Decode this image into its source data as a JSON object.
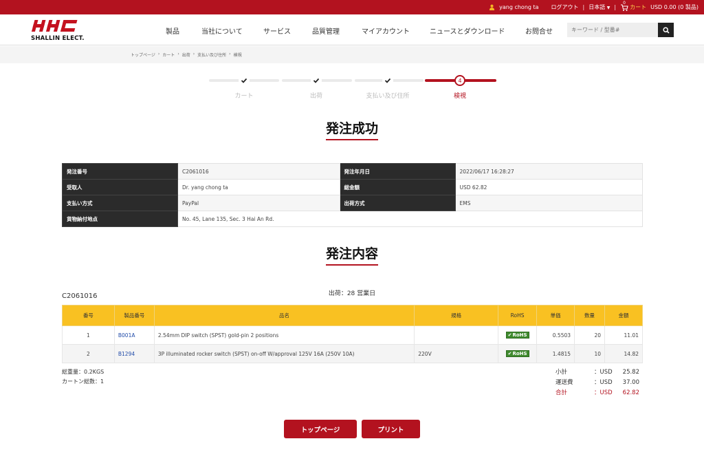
{
  "topbar": {
    "user": "yang chong ta",
    "logout": "ログアウト",
    "language": "日本語",
    "cart_count": "0",
    "cart": "カート",
    "cart_total": "USD 0.00 (0 製品)"
  },
  "header": {
    "logo_brand": "SHALLIN ELECT.",
    "nav": [
      "製品",
      "当社について",
      "サービス",
      "品質管理",
      "マイアカウント",
      "ニュースとダウンロード",
      "お問合せ"
    ],
    "search_placeholder": "キーワード / 型番#"
  },
  "breadcrumb": [
    "トップページ",
    "カート",
    "出荷",
    "支払い及び住所",
    "検視"
  ],
  "steps": {
    "labels": [
      "カート",
      "出荷",
      "支払い及び住所",
      "検視"
    ],
    "current_number": "4",
    "current_index": 4
  },
  "order_info": {
    "title": "発注成功",
    "rows": [
      {
        "k1": "発注番号",
        "v1": "C2061016",
        "k2": "発注年月日",
        "v2": "2022/06/17 16:28:27"
      },
      {
        "k1": "受取人",
        "v1": "Dr. yang chong ta",
        "k2": "総金額",
        "v2": "USD 62.82"
      },
      {
        "k1": "支払い方式",
        "v1": "PayPal",
        "k2": "出荷方式",
        "v2": "EMS"
      }
    ],
    "address_label": "貨物納付地点",
    "address": "No. 45, Lane 135, Sec. 3 Hai An Rd."
  },
  "order_contents": {
    "title": "発注内容",
    "order_no": "C2061016",
    "ship_days": "出荷：28 営業日",
    "columns": [
      "番号",
      "製品番号",
      "品名",
      "規格",
      "RoHS",
      "単価",
      "数量",
      "金額"
    ],
    "rows": [
      {
        "no": "1",
        "part": "B001A",
        "name": "2.54mm DIP switch (SPST) gold-pin 2 positions",
        "spec": "",
        "rohs": "RoHS",
        "price": "0.5503",
        "qty": "20",
        "amount": "11.01"
      },
      {
        "no": "2",
        "part": "B1294",
        "name": "3P illuminated rocker switch (SPST) on-off W/approval 125V 16A (250V 10A)",
        "spec": "220V",
        "rohs": "RoHS",
        "price": "1.4815",
        "qty": "10",
        "amount": "14.82"
      }
    ],
    "weight": "総重量：0.2KGS",
    "cartons": "カートン総数：1",
    "totals": [
      {
        "label": "小計",
        "currency": "：USD",
        "amount": "25.82"
      },
      {
        "label": "運送費",
        "currency": "：USD",
        "amount": "37.00"
      },
      {
        "label": "合計",
        "currency": "：USD",
        "amount": "62.82"
      }
    ]
  },
  "buttons": {
    "home": "トップページ",
    "print": "プリント"
  },
  "colors": {
    "brand_red": "#b3121f",
    "table_header_yellow": "#f9c122",
    "rohs_green": "#3f8a2e"
  }
}
